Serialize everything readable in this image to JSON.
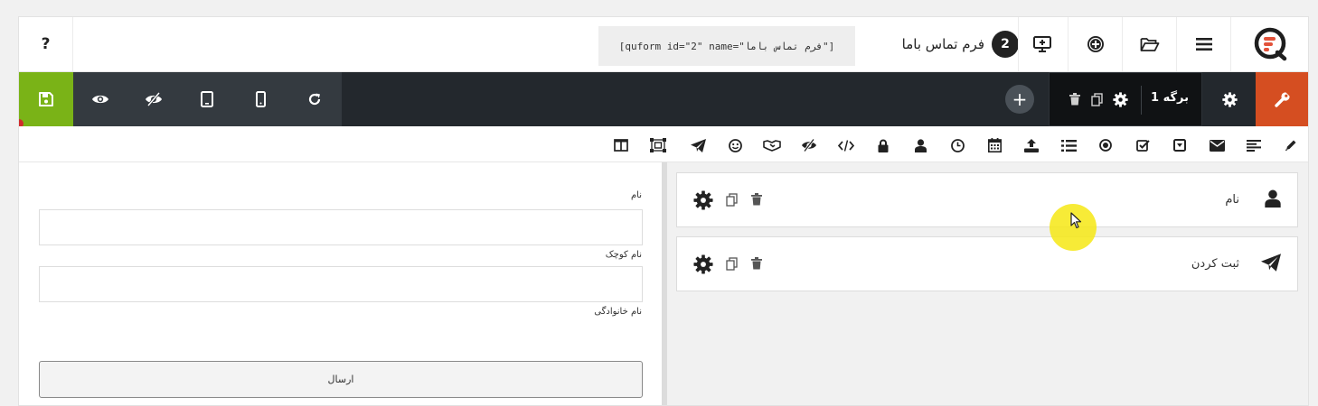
{
  "topbar": {
    "help_label": "?",
    "shortcode": "[quform id=\"2\" name=\"فرم تماس باما\"]",
    "form_number": "2",
    "form_title": "فرم تماس باما",
    "icons": [
      "question-icon",
      "desktop-preview-icon",
      "plus-circle-icon",
      "folder-open-icon",
      "hamburger-menu-icon",
      "quform-logo-icon"
    ]
  },
  "darkbar": {
    "page_label": "برگه 1",
    "add_page_label": "+",
    "icons": [
      "save-icon",
      "eye-icon",
      "eye-slash-icon",
      "tablet-icon",
      "mobile-icon",
      "refresh-icon",
      "trash-icon",
      "copy-icon",
      "gear-icon",
      "wrench-icon"
    ],
    "colors": {
      "save": "#7ab317",
      "wrench": "#d54e21",
      "bar": "#23282d",
      "group": "#343a40",
      "page": "#101214"
    }
  },
  "element_toolbar": {
    "icons": [
      "pencil-icon",
      "align-left-icon",
      "envelope-icon",
      "dropdown-icon",
      "checkbox-icon",
      "radio-icon",
      "list-icon",
      "upload-icon",
      "calendar-icon",
      "clock-icon",
      "user-icon",
      "lock-icon",
      "code-icon",
      "eye-slash-icon",
      "handshake-icon",
      "smile-icon",
      "paper-plane-icon",
      "object-group-icon",
      "columns-icon"
    ]
  },
  "preview": {
    "field1_label": "نام",
    "field2_label": "نام کوچک",
    "field3_label": "نام خانوادگی",
    "submit_label": "ارسال"
  },
  "builder": {
    "elements": [
      {
        "label": "نام",
        "icon": "user-icon"
      },
      {
        "label": "ثبت کردن",
        "icon": "paper-plane-icon"
      }
    ]
  }
}
